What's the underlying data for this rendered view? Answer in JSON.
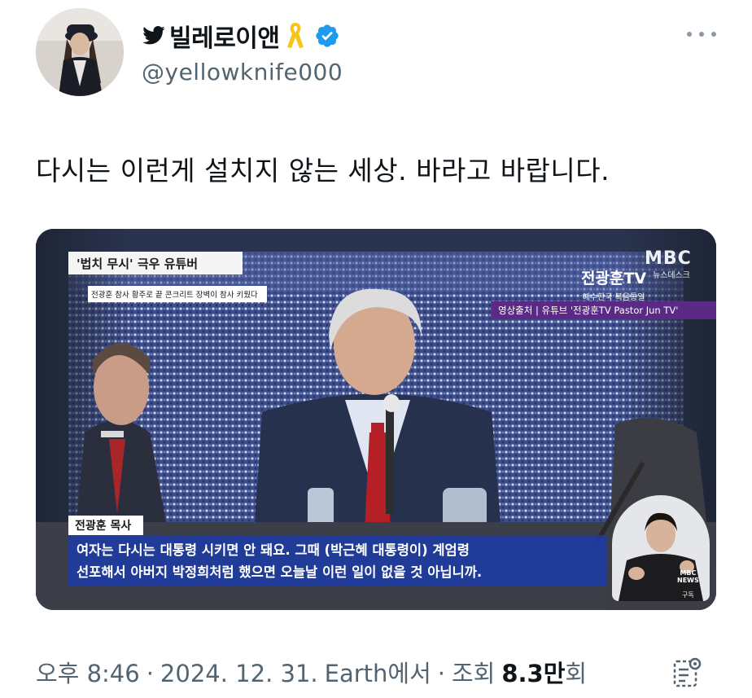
{
  "author": {
    "display_name": "빌레로이앤",
    "handle": "@yellowknife000",
    "icons": [
      "bird-icon",
      "yellow-ribbon-icon",
      "verified-badge-icon"
    ],
    "verified_color": "#1d9bf0",
    "ribbon_color": "#f5c518"
  },
  "tweet": {
    "text": "다시는 이런게 설치지 않는 세상. 바라고 바랍니다."
  },
  "media": {
    "headline": "'법치 무시' 극우 유튜버",
    "subheadline": "전광훈 참사   황주로 끝 콘크리트 장벽이 참사 키웠다",
    "broadcaster_logo": "MBC",
    "broadcaster_sub": "뉴스데스크",
    "channel_name": "전광훈TV",
    "channel_sub": "예수한국 복음통일",
    "source_label": "영상출처 | 유튜브 '전광훈TV Pastor Jun TV'",
    "speaker": "전광훈 목사",
    "caption_line1": "여자는 다시는 대통령 시키면 안 돼요. 그때 (박근혜 대통령이) 계엄령",
    "caption_line2": "선포해서 아버지 박정희처럼 했으면 오늘날 이런 일이 없을 것 아닙니까.",
    "news_badge_line1": "MBC",
    "news_badge_line2": "NEWS",
    "subscribe_label": "구독"
  },
  "meta": {
    "time": "오후 8:46",
    "date": "2024. 12. 31.",
    "source": "Earth에서",
    "views_label": "조회",
    "views_count": "8.3만",
    "views_suffix": "회",
    "separator": "·"
  },
  "colors": {
    "text_primary": "#0f1419",
    "text_secondary": "#536471",
    "caption_bg": "#1e3ca0",
    "source_bar_bg": "#5b2a86"
  }
}
